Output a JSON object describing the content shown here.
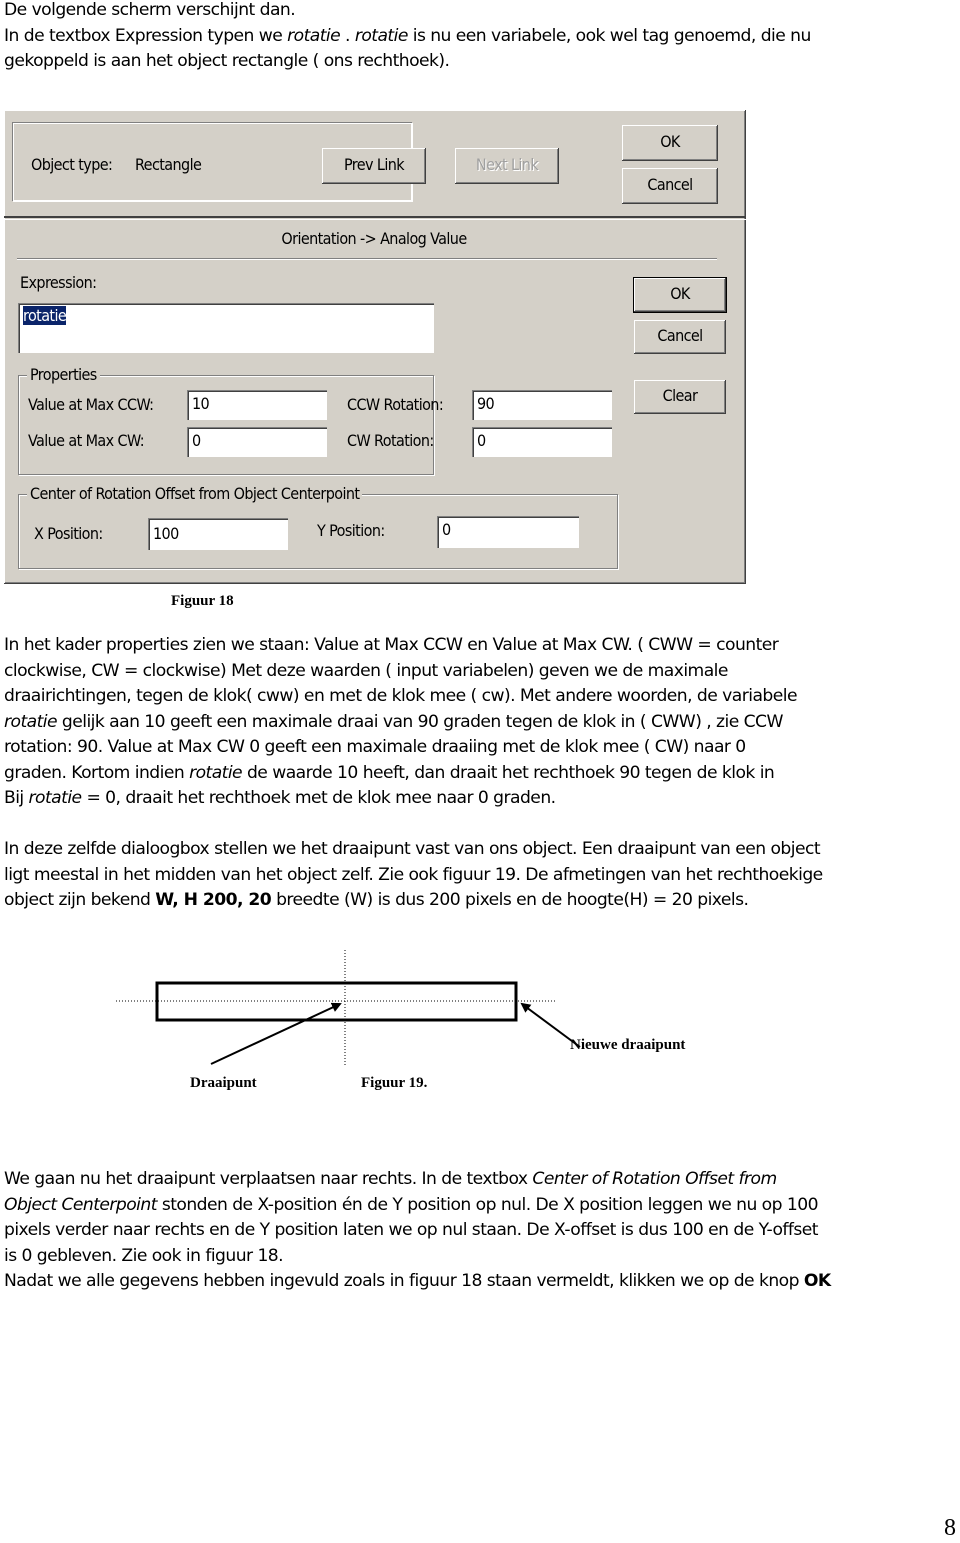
{
  "intro": {
    "line1": "De volgende scherm verschijnt dan.",
    "line2_pre": "In de textbox Expression typen we ",
    "line2_var1": "rotatie",
    "line2_mid": " .  ",
    "line2_var2": "rotatie",
    "line2_post": " is nu een variabele, ook wel tag genoemd, die nu",
    "line3": "gekoppeld is aan het object rectangle ( ons rechthoek)."
  },
  "dialog": {
    "object_type_label": "Object type:",
    "object_type_value": "Rectangle",
    "prev_link": "Prev Link",
    "next_link": "Next Link",
    "top_ok": "OK",
    "top_cancel": "Cancel",
    "section_title": "Orientation -> Analog Value",
    "expression_label": "Expression:",
    "expression_value": "rotatie",
    "ok": "OK",
    "cancel": "Cancel",
    "clear": "Clear",
    "properties": {
      "title": "Properties",
      "max_ccw_label": "Value at Max CCW:",
      "max_ccw_value": "10",
      "max_cw_label": "Value at Max CW:",
      "max_cw_value": "0",
      "ccw_rotation_label": "CCW Rotation:",
      "ccw_rotation_value": "90",
      "cw_rotation_label": "CW Rotation:",
      "cw_rotation_value": "0"
    },
    "center": {
      "title": "Center of Rotation Offset from Object Centerpoint",
      "x_label": "X Position:",
      "x_value": "100",
      "y_label": "Y Position:",
      "y_value": "0"
    }
  },
  "figure18_caption": "Figuur 18",
  "para1": {
    "l1": "In het kader properties zien we staan: Value at Max CCW en Value at Max CW. ( CWW = counter",
    "l2": "clockwise,  CW = clockwise) Met deze waarden ( input variabelen) geven we de maximale",
    "l3": "draairichtingen, tegen de klok( cww)  en met de klok mee ( cw). Met andere woorden, de variabele",
    "l4_var": "rotatie",
    "l4": " gelijk aan 10 geeft een maximale draai  van 90 graden tegen de klok in ( CWW) , zie CCW",
    "l5": "rotation: 90.  Value at Max CW  0  geeft een maximale draaiing met de klok mee ( CW) naar 0",
    "l6_pre": "graden. Kortom indien ",
    "l6_var": "rotatie",
    "l6_post": " de waarde 10 heeft, dan draait het rechthoek 90 tegen de klok in",
    "l7_pre": "Bij ",
    "l7_var": "rotatie",
    "l7_post": " = 0, draait het rechthoek met de klok mee naar 0 graden."
  },
  "para2": {
    "l1": "In deze zelfde dialoogbox stellen we het draaipunt vast van ons object. Een draaipunt van een object",
    "l2": "ligt meestal in het midden van het object zelf. Zie ook figuur 19. De afmetingen van het rechthoekige",
    "l3_pre": "object zijn bekend  ",
    "l3_bold": "W, H 200, 20",
    "l3_post": " breedte (W) is dus 200 pixels en de hoogte(H) = 20 pixels."
  },
  "figure19": {
    "label_draaipunt": "Draaipunt",
    "caption": "Figuur 19.",
    "label_nieuwe": "Nieuwe draaipunt"
  },
  "para3": {
    "l1_pre": "We gaan nu het draaipunt verplaatsen naar rechts. In de textbox ",
    "l1_ital": "Center of Rotation Offset from",
    "l2_ital": "Object Centerpoint",
    "l2_post": "  stonden de X-position én de Y position op nul. De X position leggen we nu op 100",
    "l3": "pixels verder naar rechts en de Y position laten we op nul staan. De X-offset is dus 100 en de Y-offset",
    "l4": "is 0 gebleven. Zie ook in figuur 18.",
    "l5_pre": "Nadat we alle gegevens hebben ingevuld zoals in figuur 18 staan vermeldt, klikken we op de knop ",
    "l5_bold": "OK"
  },
  "page_number": "8"
}
